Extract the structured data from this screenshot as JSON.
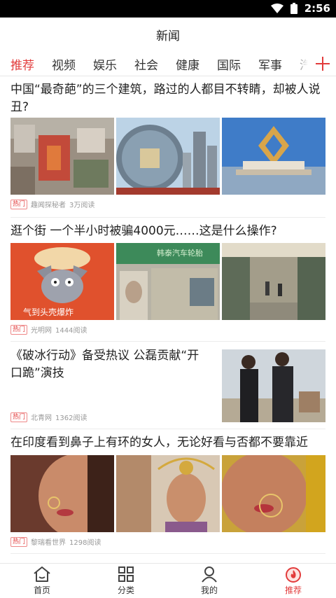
{
  "status_bar": {
    "time": "2:56"
  },
  "header": {
    "title": "新闻"
  },
  "tabs": [
    "推荐",
    "视频",
    "娱乐",
    "社会",
    "健康",
    "国际",
    "军事",
    "汽"
  ],
  "articles": [
    {
      "title": "中国“最奇葩”的三个建筑，路过的人都目不转睛，却被人说丑?",
      "badge": "热门",
      "source": "趣闻探秘者",
      "reads": "3万阅读"
    },
    {
      "title": "逛个街 一个半小时被骗4000元……这是什么操作?",
      "badge": "热门",
      "source": "光明网",
      "reads": "1444阅读",
      "image_caption": "气到头壳爆炸",
      "shop_sign": "韩泰汽车轮胎"
    },
    {
      "title": "《破冰行动》备受热议 公磊贡献“开口跪”演技",
      "badge": "热门",
      "source": "北青网",
      "reads": "1362阅读"
    },
    {
      "title": "在印度看到鼻子上有环的女人，无论好看与否都不要靠近",
      "badge": "热门",
      "source": "黎瑞看世界",
      "reads": "1298阅读"
    }
  ],
  "bottom_nav": [
    {
      "label": "首页",
      "icon": "home-icon"
    },
    {
      "label": "分类",
      "icon": "grid-icon"
    },
    {
      "label": "我的",
      "icon": "user-icon"
    },
    {
      "label": "推荐",
      "icon": "fire-icon"
    }
  ],
  "colors": {
    "accent": "#e23b3b",
    "text": "#222222",
    "meta": "#999999"
  }
}
